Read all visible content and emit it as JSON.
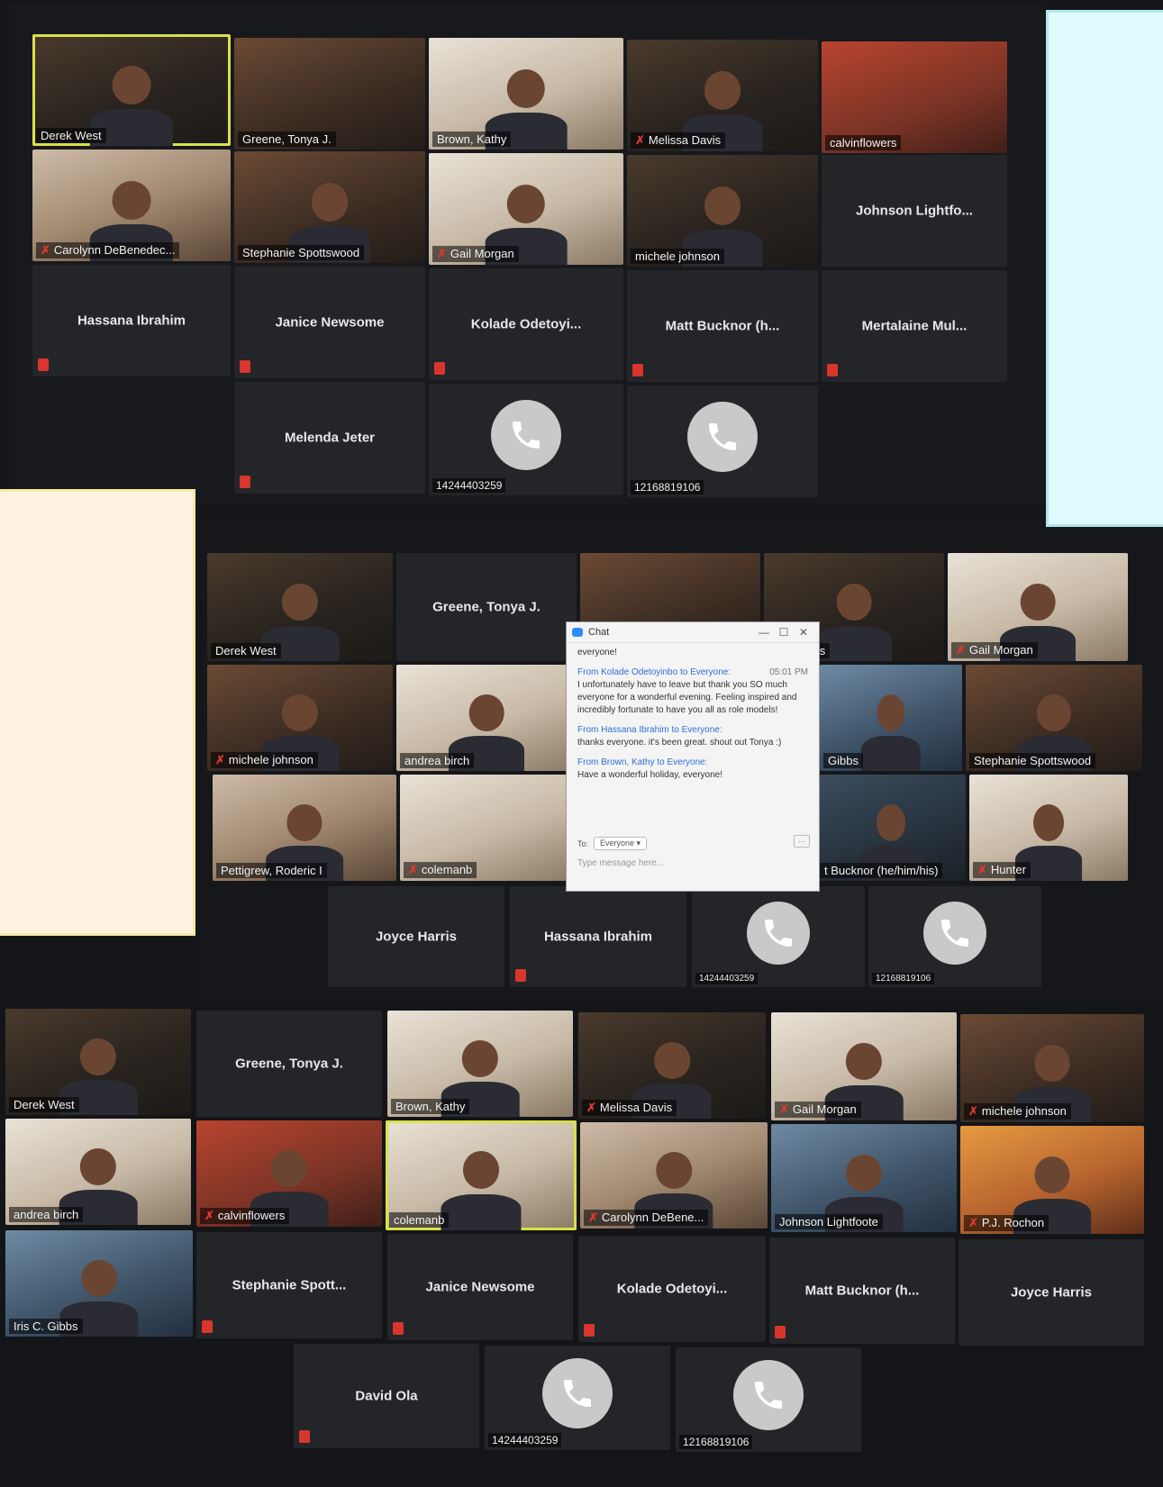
{
  "screen1": {
    "video_tiles": [
      {
        "label": "Derek West",
        "muted": false,
        "active": true
      },
      {
        "label": "Greene, Tonya J.",
        "muted": false
      },
      {
        "label": "Brown, Kathy",
        "muted": false
      },
      {
        "label": "Melissa Davis",
        "muted": true
      },
      {
        "label": "calvinflowers",
        "muted": false
      },
      {
        "label": "Carolynn DeBenedec...",
        "muted": true
      },
      {
        "label": "Stephanie Spottswood",
        "muted": false
      },
      {
        "label": "Gail Morgan",
        "muted": true
      },
      {
        "label": "michele johnson",
        "muted": false
      }
    ],
    "name_tiles": [
      "Johnson Lightfo...",
      "Hassana Ibrahim",
      "Janice Newsome",
      "Kolade  Odetoyi...",
      "Matt Bucknor (h...",
      "Mertalaine Mul...",
      "Melenda Jeter"
    ],
    "phone_tiles": [
      "14244403259",
      "12168819106"
    ]
  },
  "screen2": {
    "tiles": [
      {
        "label": "Derek West",
        "muted": false
      },
      {
        "label": "Greene, Tonya J.",
        "type": "name"
      },
      {
        "label": "issa Davis",
        "muted": false
      },
      {
        "label": "Gail Morgan",
        "muted": true
      },
      {
        "label": "michele johnson",
        "muted": true
      },
      {
        "label": "andrea birch",
        "muted": false
      },
      {
        "label": "Gibbs",
        "muted": false
      },
      {
        "label": "Stephanie Spottswood",
        "muted": false
      },
      {
        "label": "Pettigrew, Roderic I",
        "muted": false
      },
      {
        "label": "colemanb",
        "muted": true
      },
      {
        "label": "t Bucknor (he/him/his)",
        "muted": false
      },
      {
        "label": "Hunter",
        "muted": true
      }
    ],
    "name_tiles": [
      "Joyce Harris",
      "Hassana Ibrahim"
    ],
    "phone_tiles": [
      "14244403259",
      "12168819106"
    ]
  },
  "chat": {
    "title": "Chat",
    "window_buttons": {
      "minimize": "—",
      "maximize": "☐",
      "close": "✕"
    },
    "first_line": "everyone!",
    "messages": [
      {
        "from": "From Kolade Odetoyinbo to Everyone:",
        "time": "05:01 PM",
        "text": "I unfortunately have to leave but thank you SO much everyone for a wonderful evening. Feeling inspired and incredibly fortunate to have you all as role models!"
      },
      {
        "from": "From Hassana Ibrahim to Everyone:",
        "time": "",
        "text": "thanks everyone. it's been great. shout out Tonya :)"
      },
      {
        "from": "From Brown, Kathy to Everyone:",
        "time": "",
        "text": "Have a wonderful holiday, everyone!"
      }
    ],
    "to_label": "To:",
    "to_value": "Everyone ▾",
    "more": "...",
    "placeholder": "Type message here..."
  },
  "screen3": {
    "video_tiles": [
      {
        "label": "Derek West",
        "muted": false
      },
      {
        "label": "Greene, Tonya J.",
        "type": "name"
      },
      {
        "label": "Brown, Kathy",
        "muted": false
      },
      {
        "label": "Melissa Davis",
        "muted": true
      },
      {
        "label": "Gail Morgan",
        "muted": true
      },
      {
        "label": "michele johnson",
        "muted": true
      },
      {
        "label": "andrea birch",
        "muted": false
      },
      {
        "label": "calvinflowers",
        "muted": true
      },
      {
        "label": "colemanb",
        "muted": false,
        "active": true
      },
      {
        "label": "Carolynn DeBene...",
        "muted": true
      },
      {
        "label": "Johnson Lightfoote",
        "muted": false
      },
      {
        "label": "P.J. Rochon",
        "muted": true
      },
      {
        "label": "Iris C. Gibbs",
        "muted": false
      }
    ],
    "name_tiles": [
      "Stephanie  Spott...",
      "Janice Newsome",
      "Kolade  Odetoyi...",
      "Matt Bucknor (h...",
      "Joyce Harris",
      "David Ola"
    ],
    "phone_tiles": [
      "14244403259",
      "12168819106"
    ]
  }
}
